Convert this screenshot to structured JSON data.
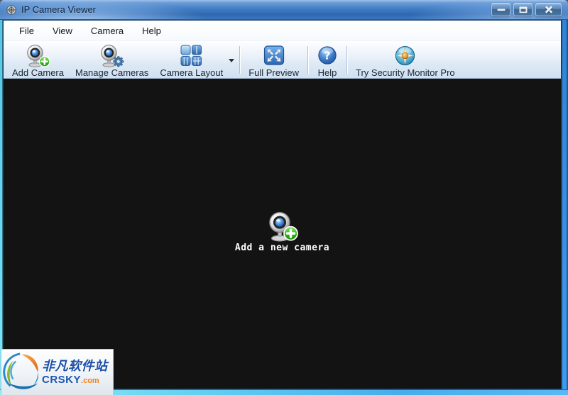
{
  "window": {
    "title": "IP Camera Viewer"
  },
  "menubar": {
    "items": [
      {
        "label": "File"
      },
      {
        "label": "View"
      },
      {
        "label": "Camera"
      },
      {
        "label": "Help"
      }
    ]
  },
  "toolbar": {
    "items": [
      {
        "label": "Add Camera",
        "icon": "webcam-add-icon"
      },
      {
        "label": "Manage Cameras",
        "icon": "webcam-gear-icon"
      },
      {
        "label": "Camera Layout",
        "icon": "grid-layout-icon"
      },
      {
        "label": "Full Preview",
        "icon": "expand-arrows-icon"
      },
      {
        "label": "Help",
        "icon": "question-icon"
      },
      {
        "label": "Try Security Monitor Pro",
        "icon": "security-monitor-icon"
      }
    ]
  },
  "icons": {
    "help_glyph": "?"
  },
  "main": {
    "empty_state_label": "Add a new camera"
  },
  "watermark": {
    "site_name": "非凡软件站",
    "site_brand": "CRSKY",
    "site_tld": ".com"
  },
  "colors": {
    "titlebar_blue": "#3f7bc3",
    "toolbar_bg": "#dde9f5",
    "main_bg": "#131313",
    "add_badge_green": "#2fae17",
    "brand_blue": "#1b4fa8",
    "brand_orange": "#f08018"
  }
}
